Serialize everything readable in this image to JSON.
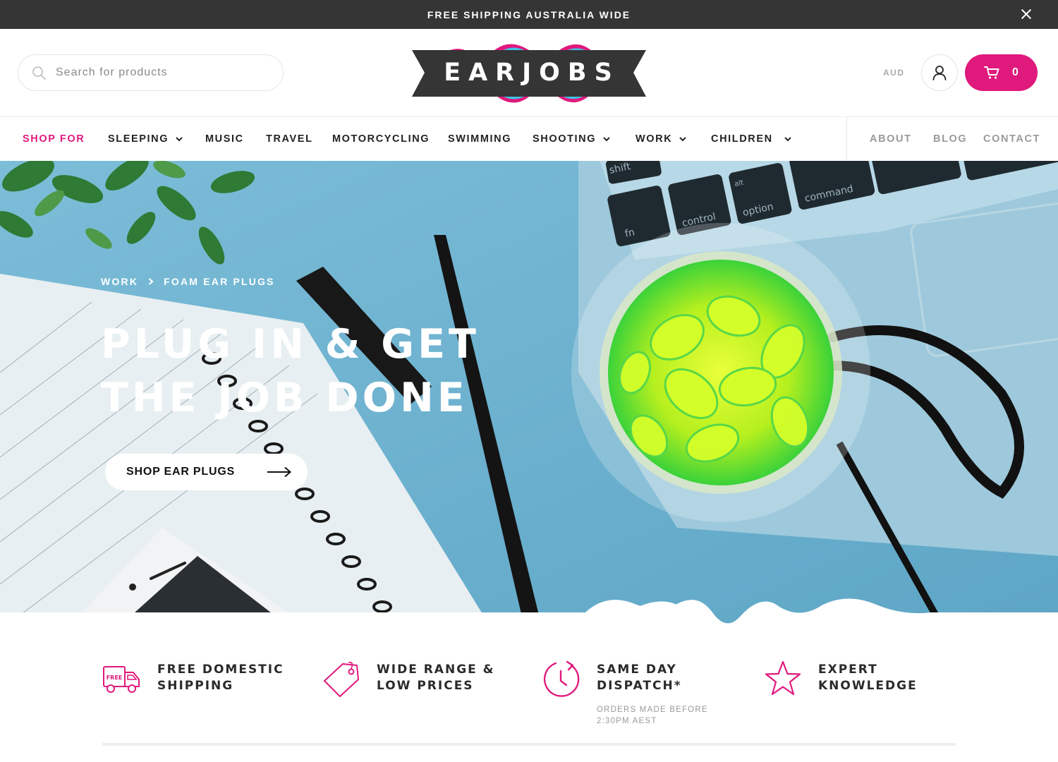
{
  "announcement": {
    "text": "FREE SHIPPING AUSTRALIA WIDE",
    "close_icon": "close-icon"
  },
  "header": {
    "search": {
      "placeholder": "Search for products",
      "icon": "search-icon"
    },
    "logo_text": "EARJOBS",
    "currency": "AUD",
    "account_icon": "user-icon",
    "cart": {
      "icon": "cart-icon",
      "count": "0"
    }
  },
  "nav": {
    "shop_for": "SHOP FOR",
    "items": [
      {
        "label": "SLEEPING",
        "dropdown": true
      },
      {
        "label": "MUSIC",
        "dropdown": false
      },
      {
        "label": "TRAVEL",
        "dropdown": false
      },
      {
        "label": "MOTORCYCLING",
        "dropdown": false
      },
      {
        "label": "SWIMMING",
        "dropdown": false
      },
      {
        "label": "SHOOTING",
        "dropdown": true
      },
      {
        "label": "WORK",
        "dropdown": true
      },
      {
        "label": "CHILDREN",
        "dropdown": true
      }
    ],
    "secondary": [
      "ABOUT",
      "BLOG",
      "CONTACT"
    ]
  },
  "hero": {
    "breadcrumb": [
      "WORK",
      "FOAM EAR PLUGS"
    ],
    "title_lines": [
      "PLUG IN & GET",
      "THE JOB DONE"
    ],
    "button_label": "SHOP EAR PLUGS",
    "keyboard_keys": [
      "shift",
      "fn",
      "control",
      "alt",
      "option",
      "command"
    ]
  },
  "features": [
    {
      "icon": "delivery-truck-icon",
      "badge": "FREE",
      "title": [
        "FREE DOMESTIC",
        "SHIPPING"
      ],
      "note": ""
    },
    {
      "icon": "price-tag-icon",
      "title": [
        "WIDE RANGE &",
        "LOW PRICES"
      ],
      "note": ""
    },
    {
      "icon": "clock-icon",
      "title": [
        "SAME DAY",
        "DISPATCH*"
      ],
      "note": "ORDERS MADE BEFORE 2:30PM AEST"
    },
    {
      "icon": "star-icon",
      "title": [
        "EXPERT",
        "KNOWLEDGE"
      ],
      "note": ""
    }
  ],
  "colors": {
    "accent": "#e0197d",
    "hero_blue": "#6ab1cf",
    "dark": "#353535"
  }
}
